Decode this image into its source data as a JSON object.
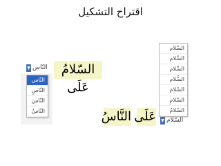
{
  "title": "اقتراح التشكيل",
  "left": {
    "word_main": "السّلامُ عَلَى",
    "dropdown_value": "النّاس",
    "options": [
      "النّاس",
      "النّاسِ",
      "النّاسَ",
      "النّاسُ"
    ]
  },
  "right": {
    "word_1": "عَلَى",
    "word_2": "النَّاسُ",
    "dropdown_value": "السّلام",
    "options": [
      "السّلام",
      "السَّلام",
      "السِّلام",
      "السُّلام",
      "السّلامَ",
      "السّلامِ",
      "السّلامُ"
    ]
  },
  "colors": {
    "word_highlight": "#f5f5c8",
    "selection": "#2b63c4",
    "arrow": "#4a6fb0"
  }
}
